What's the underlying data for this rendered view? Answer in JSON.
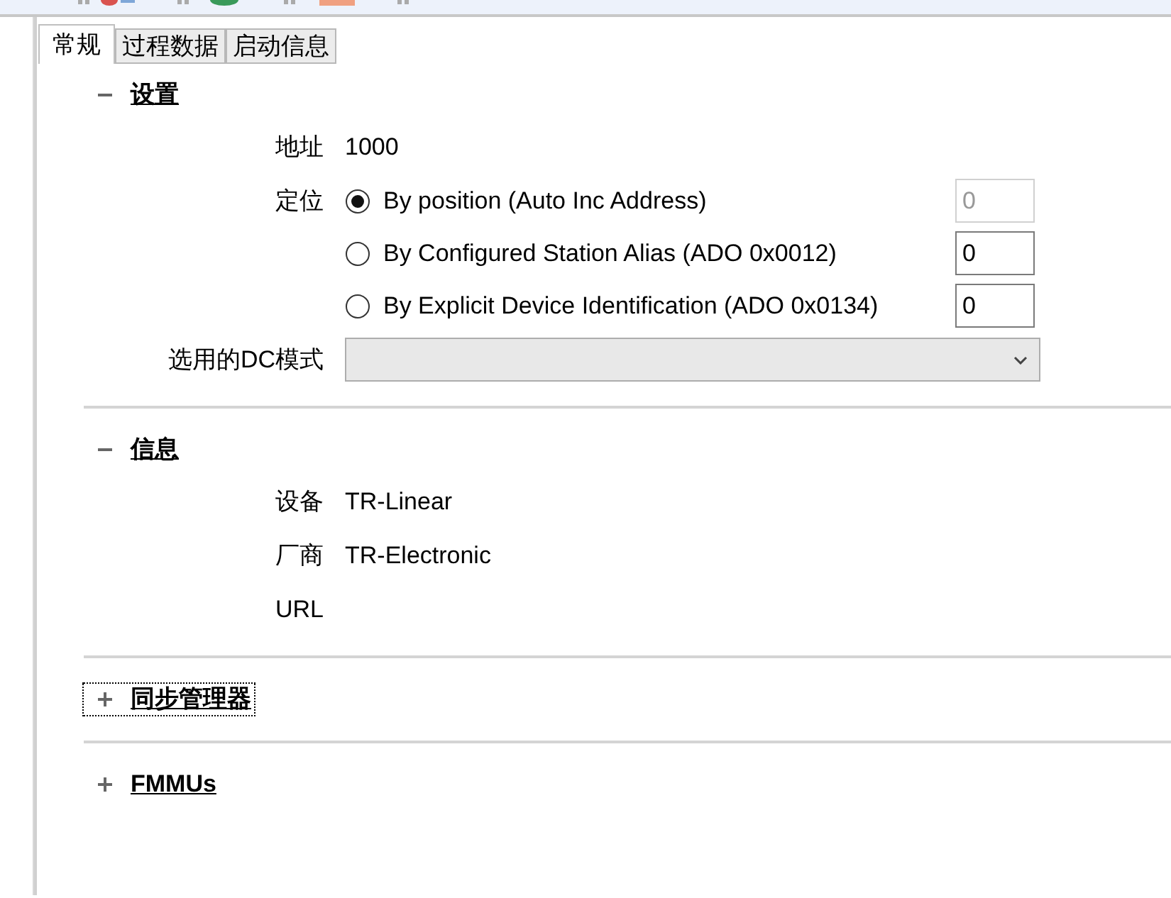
{
  "tabs": [
    {
      "label": "常规",
      "selected": true
    },
    {
      "label": "过程数据",
      "selected": false
    },
    {
      "label": "启动信息",
      "selected": false
    }
  ],
  "sections": [
    {
      "title": "设置",
      "expanded": true,
      "focused": false,
      "rows": [
        {
          "kind": "value",
          "label": "地址",
          "value": "1000"
        },
        {
          "kind": "radio",
          "label": "定位",
          "options": [
            {
              "text": "By position (Auto Inc Address)",
              "selected": true,
              "field": {
                "value": "0",
                "disabled": true
              }
            },
            {
              "text": "By Configured Station Alias (ADO 0x0012)",
              "selected": false,
              "field": {
                "value": "0",
                "disabled": false
              }
            },
            {
              "text": "By Explicit Device Identification (ADO 0x0134)",
              "selected": false,
              "field": {
                "value": "0",
                "disabled": false
              }
            }
          ]
        },
        {
          "kind": "dropdown",
          "label": "选用的DC模式"
        }
      ]
    },
    {
      "title": "信息",
      "expanded": true,
      "focused": false,
      "rows": [
        {
          "kind": "value",
          "label": "设备",
          "value": "TR-Linear"
        },
        {
          "kind": "value",
          "label": "厂商",
          "value": "TR-Electronic"
        },
        {
          "kind": "value",
          "label": "URL"
        }
      ]
    },
    {
      "title": "同步管理器",
      "expanded": false,
      "focused": true
    },
    {
      "title": "FMMUs",
      "expanded": false,
      "focused": false
    }
  ]
}
